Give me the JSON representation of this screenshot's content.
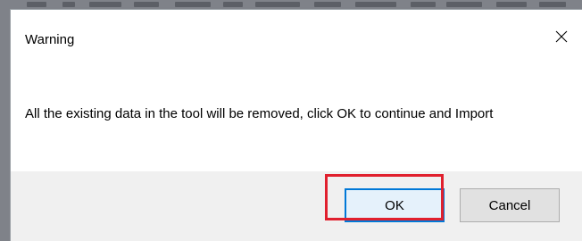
{
  "dialog": {
    "title": "Warning",
    "close_icon": "close-icon",
    "message": "All the existing data in the tool will be removed, click OK to continue and Import",
    "buttons": {
      "ok_label": "OK",
      "cancel_label": "Cancel"
    }
  },
  "annotation": {
    "highlight_color": "#e0202e",
    "highlight_target": "ok-button"
  },
  "colors": {
    "default_button_border": "#0078d7",
    "footer_background": "#f0f0f0"
  }
}
